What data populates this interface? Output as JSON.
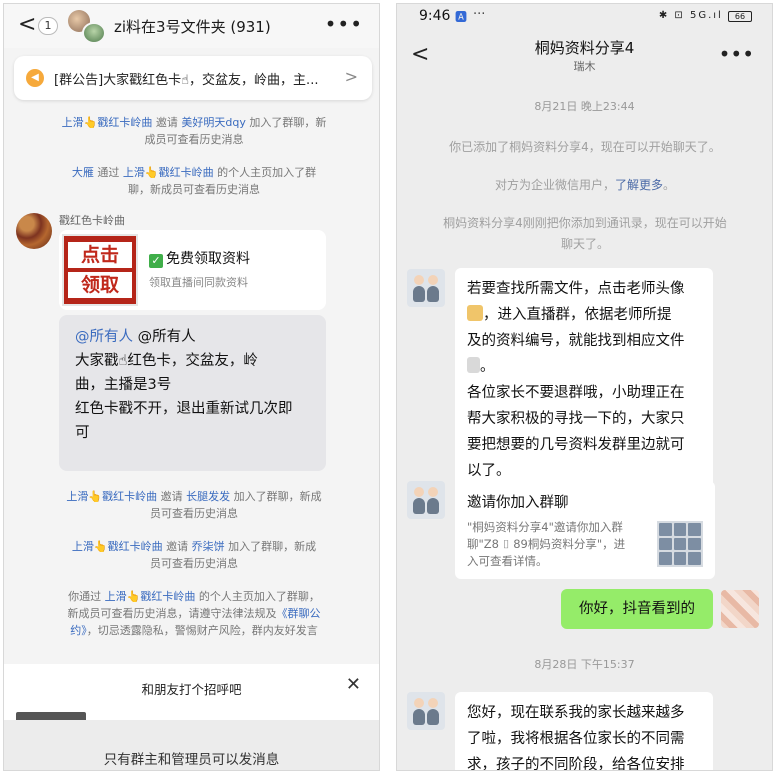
{
  "left": {
    "header": {
      "back": "<",
      "unread": "1",
      "title": "zi料在3号文件夹 (931)",
      "more": "•••"
    },
    "notice": {
      "icon": "speaker-icon",
      "text": "[群公告]大家戳红色卡☝，交盆友，岭曲，主...",
      "arrow": ">"
    },
    "sys1": {
      "a": "上滑👆戳红卡岭曲",
      "b": " 邀请 ",
      "c": "美好明天dqy",
      "d": " 加入了群聊，新",
      "e": "成员可查看历史消息"
    },
    "sys2": {
      "a": "大雁",
      "b": " 通过 ",
      "c": "上滑👆戳红卡岭曲",
      "d": " 的个人主页加入了群",
      "e": "聊，新成员可查看历史消息"
    },
    "message": {
      "sender": "戳红色卡岭曲",
      "card": {
        "img_line1": "点击",
        "img_line2": "领取",
        "check": "✓",
        "title": "免费领取资料",
        "subtitle": "领取直播间同款资料"
      },
      "bubble": {
        "line1_at": "@所有人",
        "line1_rest": " @所有人",
        "line2": "大家戳☝红色卡，交盆友，岭",
        "line3": "曲，主播是3号",
        "line4": "红色卡戳不开，退出重新试几次即",
        "line5": "可"
      }
    },
    "sys3": {
      "a": "上滑👆戳红卡岭曲",
      "b": " 邀请 ",
      "c": "长腿发发",
      "d": " 加入了群聊，新成",
      "e": "员可查看历史消息"
    },
    "sys4": {
      "a": "上滑👆戳红卡岭曲",
      "b": " 邀请 ",
      "c": "乔柒饼",
      "d": " 加入了群聊，新成",
      "e": "员可查看历史消息"
    },
    "sys5": {
      "a": "你通过 ",
      "b": "上滑👆戳红卡岭曲",
      "c": " 的个人主页加入了群聊，",
      "d": "新成员可查看历史消息，请遵守法律法规及",
      "e": "《群聊公",
      "f": "约》",
      "g": "，切忌透露隐私，警惕财产风险，群内友好发言"
    },
    "greet": {
      "text": "和朋友打个招呼吧",
      "close": "✕"
    },
    "bottom": "只有群主和管理员可以发消息",
    "colors": {
      "link": "#3a6bbf"
    }
  },
  "right": {
    "status": {
      "time": "9:46",
      "icons": "🅰",
      "dots": "···",
      "right": "✱ ⊡ 5G.ıl",
      "battery": "66"
    },
    "header": {
      "back": "<",
      "title": "桐妈资料分享4",
      "subtitle": "瑞木",
      "more": "•••"
    },
    "ts1": "8月21日 晚上23:44",
    "sys1": "你已添加了桐妈资料分享4，现在可以开始聊天了。",
    "sys2": {
      "a": "对方为企业微信用户，",
      "b": "了解更多",
      "c": "。"
    },
    "sys3": {
      "a": "桐妈资料分享4刚刚把你添加到通讯录，现在可以开始",
      "b": "聊天了。"
    },
    "msg1": {
      "l1": "若要查找所需文件，点击老师头像",
      "l2": "，进入直播群，依据老师所提",
      "l3": "及的资料编号，就能找到相应文件",
      "l4": "。",
      "l5": "各位家长不要退群哦，小助理正在",
      "l6": "帮大家积极的寻找一下的，大家只",
      "l7": "要把想要的几号资料发群里边就可",
      "l8": "以了。"
    },
    "invite": {
      "title": "邀请你加入群聊",
      "desc1": "\"桐妈资料分享4\"邀请你加入群",
      "desc2": "聊\"Z8 ⌷ 89桐妈资料分享\"，进",
      "desc3": "入可查看详情。"
    },
    "out": "你好，抖音看到的",
    "ts2": "8月28日 下午15:37",
    "msg2": {
      "l1": "您好，现在联系我的家长越来越多",
      "l2": "了啦，我将根据各位家长的不同需",
      "l3": "求，孩子的不同阶段，给各位安排"
    },
    "colors": {
      "outgoing": "#95ec69",
      "link": "#4b6aa7"
    }
  }
}
